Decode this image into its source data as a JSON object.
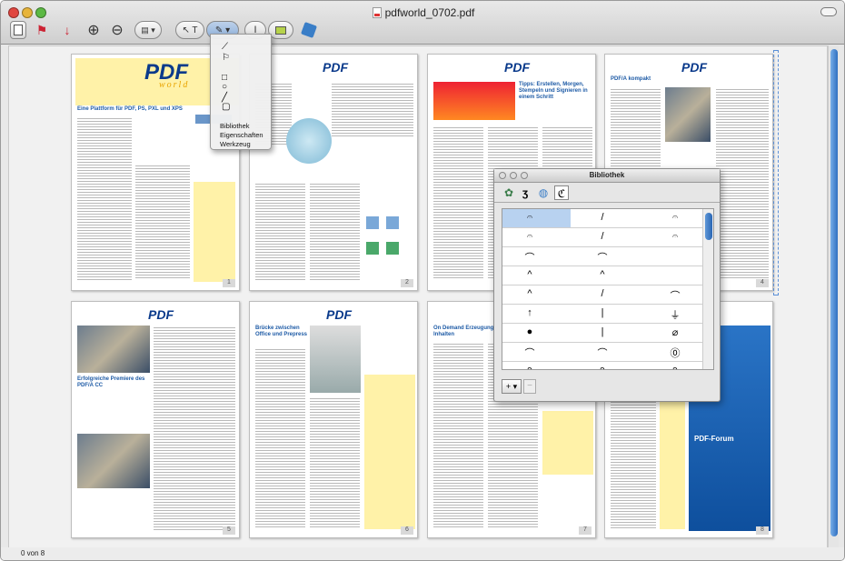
{
  "window": {
    "title": "pdfworld_0702.pdf"
  },
  "toolbar": {
    "buttons": [
      "sidebar-icon",
      "bookmark-icon",
      "export-icon",
      "zoom-in-icon",
      "zoom-out-icon",
      "view-select",
      "select-tool",
      "annotate-tool",
      "text-tool",
      "highlight-color",
      "share-icon"
    ]
  },
  "menu": {
    "items": [
      "Bibliothek",
      "Eigenschaften",
      "Werkzeug"
    ]
  },
  "library": {
    "title": "Bibliothek",
    "add_label": "+ ▾",
    "remove_label": "−",
    "rows": [
      [
        "𝄐",
        "/",
        "𝄐"
      ],
      [
        "𝄐",
        "/",
        "𝄐"
      ],
      [
        "⌒",
        "⌒",
        ""
      ],
      [
        "^",
        "^",
        ""
      ],
      [
        "^",
        "/",
        "⌒"
      ],
      [
        "↑",
        "|",
        "⏚"
      ],
      [
        "●",
        "|",
        "⌀"
      ],
      [
        "⌒",
        "⌒",
        "⓪"
      ],
      [
        "ↄ",
        "ↄ",
        "ↄ"
      ],
      [
        "↑",
        "ↄ",
        "⌀"
      ],
      [
        "✳",
        "›",
        "Ⓛ"
      ]
    ]
  },
  "pages": [
    {
      "num": "1",
      "headline": "Eine Plattform für PDF, PS, PXL und XPS"
    },
    {
      "num": "2",
      "headline": ""
    },
    {
      "num": "3",
      "headline": "Tipps: Erstellen, Morgen, Stempeln und Signieren in einem Schritt"
    },
    {
      "num": "4",
      "headline": "PDF/A kompakt"
    },
    {
      "num": "5",
      "headline": "Erfolgreiche Premiere des PDF/A CC"
    },
    {
      "num": "6",
      "headline": "Brücke zwischen Office und Prepress"
    },
    {
      "num": "7",
      "headline": "On Demand Erzeugung von Inhalten"
    },
    {
      "num": "8",
      "headline": "PDF-Forum"
    }
  ],
  "status": {
    "page_info": "0 von 8"
  }
}
